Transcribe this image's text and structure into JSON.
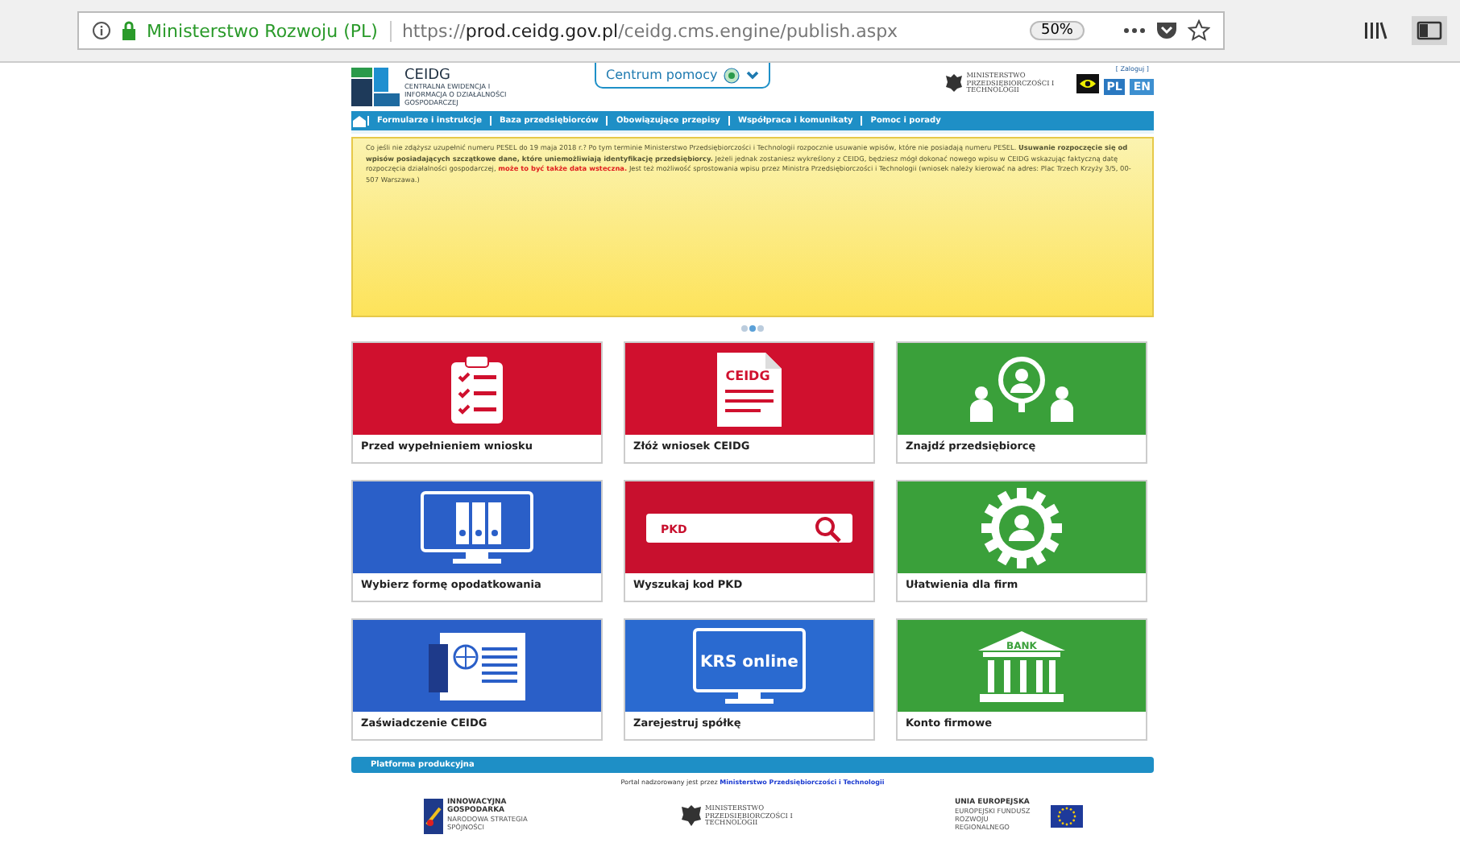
{
  "browser": {
    "site_identity": "Ministerstwo Rozwoju (PL)",
    "url": "https://**prod.ceidg.gov.pl**/ceidg.cms.engine/publish.aspx",
    "zoom": "50%"
  },
  "header": {
    "logo_title": "CEIDG",
    "logo_subtitle": "CENTRALNA EWIDENCJA I INFORMACJA O DZIAŁALNOŚCI GOSPODARCZEJ",
    "help_tab": "Centrum pomocy",
    "login": "[ Zaloguj ]",
    "ministry": "MINISTERSTWO PRZEDSIĘBIORCZOŚCI I TECHNOLOGII",
    "languages": [
      {
        "label": "PL",
        "selected": true
      },
      {
        "label": "EN",
        "selected": false
      }
    ]
  },
  "nav": [
    "Formularze i instrukcje",
    "Baza przedsiębiorców",
    "Obowiązujące przepisy",
    "Współpraca i komunikaty",
    "Pomoc i porady"
  ],
  "notice": [
    {
      "kind": "normal",
      "text": "Co jeśli nie zdążysz uzupełnić numeru PESEL do 19 maja 2018 r.? Po tym terminie Ministerstwo Przedsiębiorczości i Technologii rozpocznie usuwanie wpisów, które nie posiadają numeru PESEL. "
    },
    {
      "kind": "bold",
      "text": "Usuwanie rozpoczęcie się od wpisów posiadających szczątkowe dane, które uniemożliwiają identyfikację przedsiębiorcy."
    },
    {
      "kind": "normal",
      "text": " Jeżeli jednak zostaniesz wykreślony z CEIDG, będziesz mógł dokonać nowego wpisu w CEIDG wskazując faktyczną datę rozpoczęcia działalności gospodarczej, "
    },
    {
      "kind": "red",
      "text": "może to być także data wsteczna."
    },
    {
      "kind": "normal",
      "text": " Jest też możliwość sprostowania wpisu przez Ministra Przedsiębiorczości i Technologii (wniosek należy kierować na adres: Plac Trzech Krzyży 3/5, 00-507 Warszawa.)"
    }
  ],
  "slider_dots": [
    {
      "selected": false
    },
    {
      "selected": true
    },
    {
      "selected": false
    }
  ],
  "tiles": [
    {
      "label": "Przed wypełnieniem wniosku",
      "color": "#d0102e",
      "kind": "checklist"
    },
    {
      "label": "Złóż wniosek CEIDG",
      "color": "#d0102e",
      "kind": "document",
      "icon_text": "CEIDG"
    },
    {
      "label": "Znajdź przedsiębiorcę",
      "color": "#3aa03a",
      "kind": "people"
    },
    {
      "label": "Wybierz formę opodatkowania",
      "color": "#2a5fc8",
      "kind": "monitor"
    },
    {
      "label": "Wyszukaj kod PKD",
      "color": "#c8102e",
      "kind": "search",
      "icon_text": "PKD"
    },
    {
      "label": "Ułatwienia dla firm",
      "color": "#3aa03a",
      "kind": "gear"
    },
    {
      "label": "Zaświadczenie CEIDG",
      "color": "#2a5fc8",
      "kind": "certificate"
    },
    {
      "label": "Zarejestruj spółkę",
      "color": "#2a6ad0",
      "kind": "screen",
      "icon_text": "KRS online"
    },
    {
      "label": "Konto firmowe",
      "color": "#3aa03a",
      "kind": "bank",
      "icon_text": "BANK"
    }
  ],
  "footer": {
    "bar": "Platforma produkcyjna",
    "supervision": [
      {
        "kind": "normal",
        "text": "Portal nadzorowany jest przez "
      },
      {
        "kind": "link",
        "text": "Ministerstwo Przedsiębiorczości i Technologii"
      }
    ],
    "logos": [
      {
        "kind": "innovation",
        "title": "INNOWACYJNA GOSPODARKA",
        "subtitle": "NARODOWA STRATEGIA SPÓJNOŚCI"
      },
      {
        "kind": "ministry",
        "title": "MINISTERSTWO PRZEDSIĘBIORCZOŚCI I TECHNOLOGII"
      },
      {
        "kind": "eu",
        "title": "UNIA EUROPEJSKA",
        "subtitle": "EUROPEJSKI FUNDUSZ ROZWOJU REGIONALNEGO"
      }
    ]
  }
}
